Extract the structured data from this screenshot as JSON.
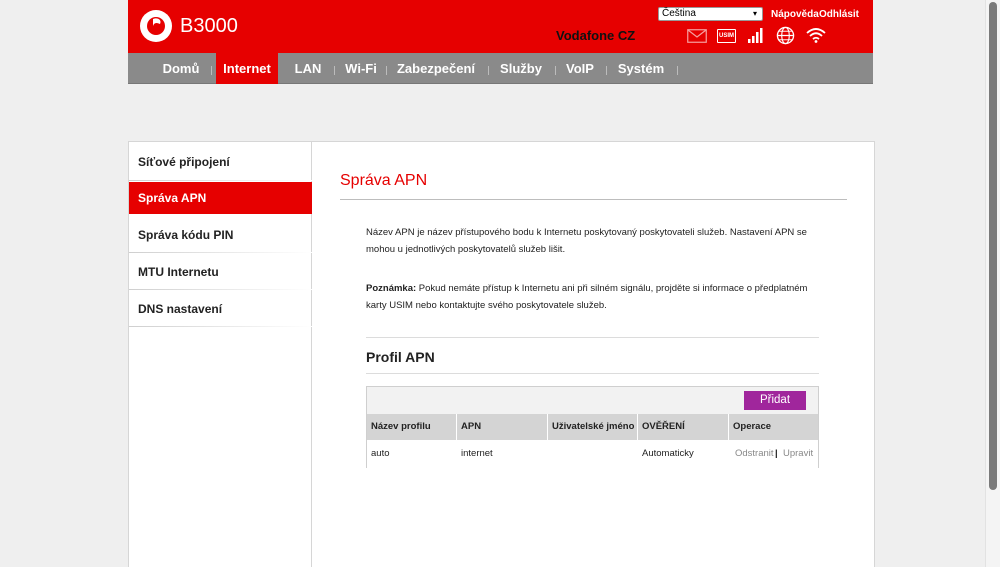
{
  "header": {
    "device_name": "B3000",
    "language": "Čeština",
    "help_link": "Nápověda",
    "logout_link": "Odhlásit",
    "operator": "Vodafone CZ",
    "usim_label": "USIM",
    "signal_bars": 4,
    "colors": {
      "brand_red": "#e60000",
      "nav_gray": "#8a8a8a",
      "accent_purple": "#a0269c"
    }
  },
  "nav": {
    "items": [
      {
        "label": "Domů"
      },
      {
        "label": "Internet",
        "active": true
      },
      {
        "label": "LAN"
      },
      {
        "label": "Wi-Fi"
      },
      {
        "label": "Zabezpečení"
      },
      {
        "label": "Služby"
      },
      {
        "label": "VoIP"
      },
      {
        "label": "Systém"
      }
    ]
  },
  "sidebar": {
    "items": [
      {
        "label": "Síťové připojení"
      },
      {
        "label": "Správa APN",
        "active": true
      },
      {
        "label": "Správa kódu PIN"
      },
      {
        "label": "MTU Internetu"
      },
      {
        "label": "DNS nastavení"
      }
    ]
  },
  "main": {
    "title": "Správa APN",
    "description": "Název APN je název přístupového bodu k Internetu poskytovaný poskytovateli služeb. Nastavení APN se mohou u jednotlivých poskytovatelů služeb lišit.",
    "note_label": "Poznámka:",
    "note_text": " Pokud nemáte přístup k Internetu ani při silném signálu, projděte si informace o předplatném karty USIM nebo kontaktujte svého poskytovatele služeb.",
    "section_title": "Profil APN",
    "add_button": "Přidat",
    "table": {
      "headers": [
        "Název profilu",
        "APN",
        "Uživatelské jméno",
        "OVĚŘENÍ",
        "Operace"
      ],
      "rows": [
        {
          "profile": "auto",
          "apn": "internet",
          "username": "",
          "auth": "Automaticky",
          "op_delete": "Odstranit",
          "op_separator": "|",
          "op_edit": "Upravit"
        }
      ]
    }
  }
}
